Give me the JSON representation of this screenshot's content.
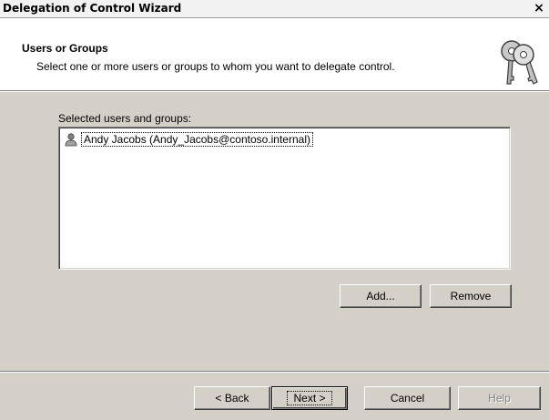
{
  "window": {
    "title": "Delegation of Control Wizard",
    "close_glyph": "×"
  },
  "header": {
    "title": "Users or Groups",
    "subtitle": "Select one or more users or groups to whom you want to delegate control.",
    "icon": "keys-icon"
  },
  "main": {
    "list_label": "Selected users and groups:",
    "items": [
      {
        "label": "Andy Jacobs (Andy_Jacobs@contoso.internal)",
        "icon": "user-icon"
      }
    ],
    "add_label": "Add...",
    "remove_label": "Remove"
  },
  "footer": {
    "back_label": "< Back",
    "next_label": "Next >",
    "cancel_label": "Cancel",
    "help_label": "Help"
  }
}
